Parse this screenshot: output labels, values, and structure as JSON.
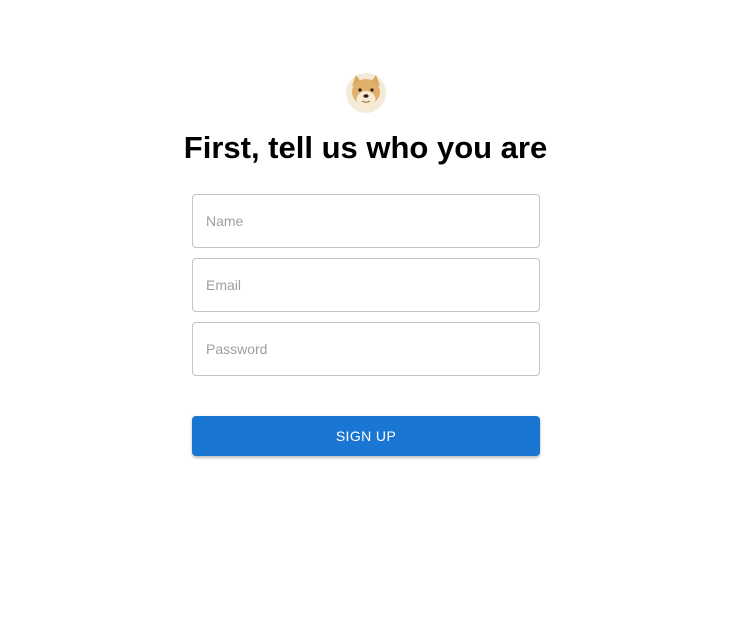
{
  "logo": {
    "icon": "doge-avatar-icon"
  },
  "heading": {
    "text": "First, tell us who you are"
  },
  "form": {
    "name_placeholder": "Name",
    "email_placeholder": "Email",
    "password_placeholder": "Password",
    "name_value": "",
    "email_value": "",
    "password_value": "",
    "submit_label": "SIGN UP"
  },
  "colors": {
    "primary": "#1976d2",
    "input_border": "#c4c4c4",
    "placeholder": "#9e9e9e"
  }
}
